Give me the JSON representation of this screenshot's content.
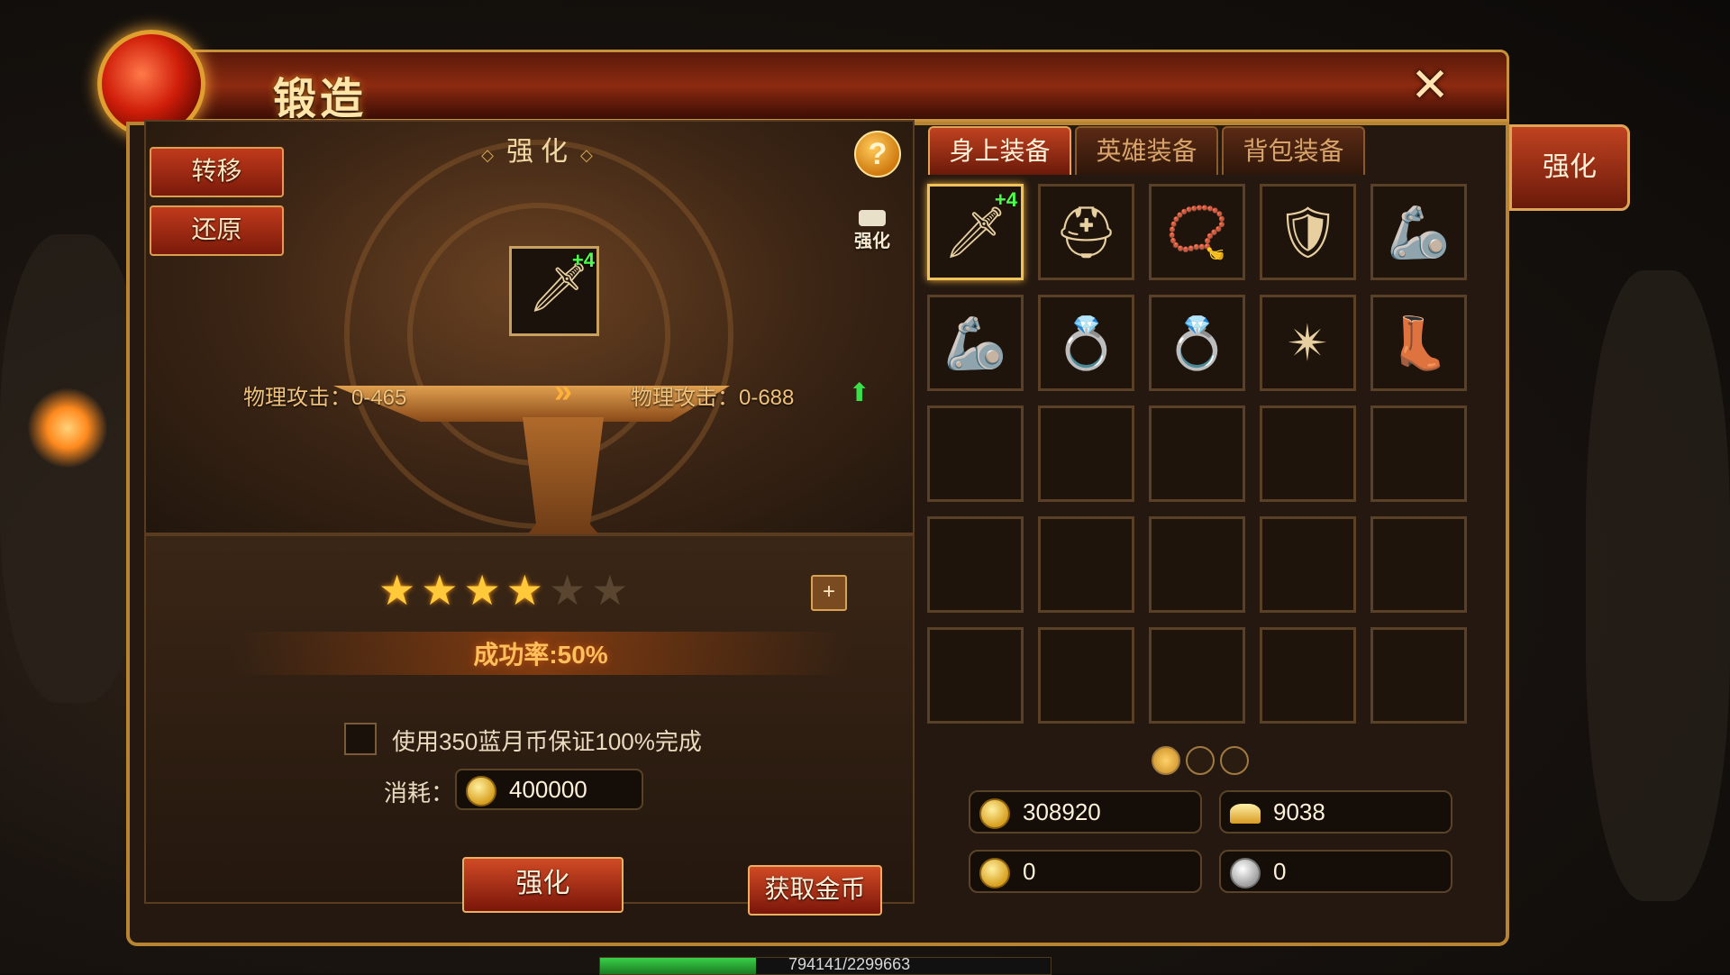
{
  "title": "锻造",
  "left": {
    "transfer_label": "转移",
    "restore_label": "还原",
    "heading": "强化",
    "help": "?",
    "hammer_label": "强化",
    "item_plus": "+4",
    "stat_before": "物理攻击：0-465",
    "stat_after": "物理攻击：0-688",
    "stars_filled": 4,
    "stars_total": 6,
    "plus_btn": "+",
    "success_rate": "成功率:50%",
    "guarantee_text": "使用350蓝月币保证100%完成",
    "cost_label": "消耗：",
    "cost_value": "400000",
    "enhance_button": "强化",
    "get_gold_button": "获取金币"
  },
  "tabs": [
    {
      "label": "身上装备",
      "active": true
    },
    {
      "label": "英雄装备",
      "active": false
    },
    {
      "label": "背包装备",
      "active": false
    }
  ],
  "side_tab_label": "强化",
  "equipment": [
    {
      "icon": "sword-icon",
      "glyph": "🗡",
      "plus": "+4",
      "selected": true
    },
    {
      "icon": "helmet-icon",
      "glyph": "⛑",
      "plus": "",
      "selected": false
    },
    {
      "icon": "necklace-icon",
      "glyph": "📿",
      "plus": "",
      "selected": false
    },
    {
      "icon": "armor-icon",
      "glyph": "🛡",
      "plus": "",
      "selected": false
    },
    {
      "icon": "bracer-icon",
      "glyph": "🦾",
      "plus": "",
      "selected": false
    },
    {
      "icon": "bracer-icon",
      "glyph": "🦾",
      "plus": "",
      "selected": false
    },
    {
      "icon": "ring-icon",
      "glyph": "💍",
      "plus": "",
      "selected": false
    },
    {
      "icon": "ring-icon",
      "glyph": "💍",
      "plus": "",
      "selected": false
    },
    {
      "icon": "belt-icon",
      "glyph": "✴",
      "plus": "",
      "selected": false
    },
    {
      "icon": "boots-icon",
      "glyph": "👢",
      "plus": "",
      "selected": false
    }
  ],
  "grid_slots_total": 25,
  "pages": {
    "count": 3,
    "active": 0
  },
  "currencies": {
    "locked_gold": "308920",
    "ingot": "9038",
    "gold": "0",
    "silver": "0"
  },
  "exp": {
    "text": "794141/2299663",
    "fraction": 0.345
  },
  "colors": {
    "accent": "#c04220",
    "gold": "#ffc93a",
    "green": "#3ae04a"
  }
}
